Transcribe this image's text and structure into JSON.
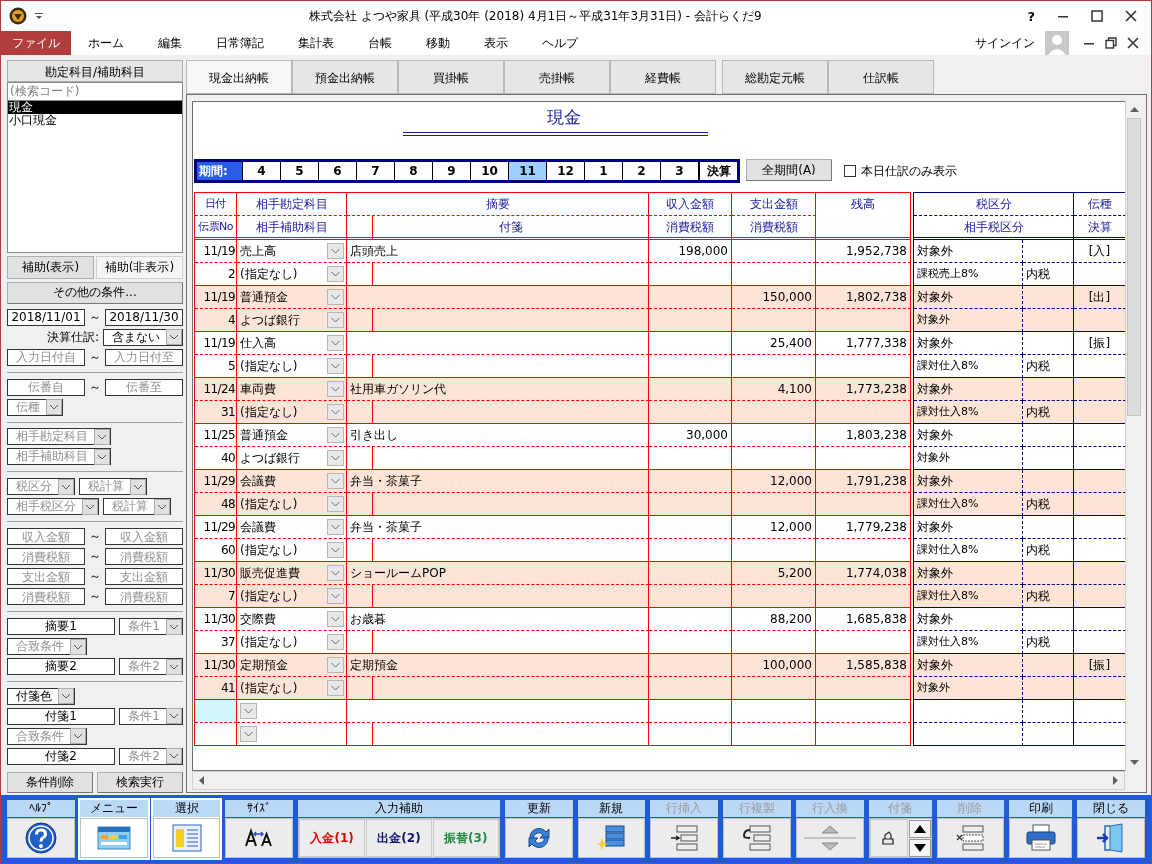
{
  "window": {
    "title": "株式会社 よつや家具 (平成30年 (2018) 4月1日～平成31年3月31日) - 会計らくだ9",
    "help": "?"
  },
  "menu": [
    {
      "label": "ファイル",
      "selected": true
    },
    {
      "label": "ホーム",
      "selected": false
    },
    {
      "label": "編集",
      "selected": false
    },
    {
      "label": "日常簿記",
      "selected": false
    },
    {
      "label": "集計表",
      "selected": false
    },
    {
      "label": "台帳",
      "selected": false
    },
    {
      "label": "移動",
      "selected": false
    },
    {
      "label": "表示",
      "selected": false
    },
    {
      "label": "ヘルプ",
      "selected": false
    }
  ],
  "account": {
    "label": "サインイン"
  },
  "sidebar": {
    "header": "勘定科目/補助科目",
    "search_placeholder": "(検索コード)",
    "accounts": [
      {
        "label": "現金",
        "selected": true
      },
      {
        "label": "小口現金",
        "selected": false
      }
    ],
    "tabs": [
      {
        "label": "補助(表示)",
        "selected": false
      },
      {
        "label": "補助(非表示)",
        "selected": true
      }
    ],
    "more_button": "その他の条件...",
    "filter_groups": [
      [
        [
          {
            "kind": "field",
            "value": "2018/11/01"
          },
          {
            "kind": "tilde",
            "text": "～"
          },
          {
            "kind": "field",
            "value": "2018/11/30"
          }
        ],
        [
          {
            "kind": "label",
            "text": "決算仕訳:"
          },
          {
            "kind": "combo",
            "value": "含まない"
          }
        ],
        [
          {
            "kind": "field",
            "placeholder": "入力日付自"
          },
          {
            "kind": "tilde",
            "text": "～"
          },
          {
            "kind": "field",
            "placeholder": "入力日付至"
          }
        ]
      ],
      [
        [
          {
            "kind": "field",
            "placeholder": "伝番自"
          },
          {
            "kind": "tilde",
            "text": "～"
          },
          {
            "kind": "field",
            "placeholder": "伝番至"
          }
        ],
        [
          {
            "kind": "combo",
            "placeholder": "伝種"
          }
        ]
      ],
      [
        [
          {
            "kind": "combo",
            "placeholder": "相手勘定科目"
          }
        ],
        [
          {
            "kind": "combo",
            "placeholder": "相手補助科目"
          }
        ]
      ],
      [
        [
          {
            "kind": "combo",
            "placeholder": "税区分"
          },
          {
            "kind": "combo",
            "placeholder": "税計算"
          }
        ],
        [
          {
            "kind": "combo",
            "placeholder": "相手税区分"
          },
          {
            "kind": "combo",
            "placeholder": "税計算"
          }
        ]
      ],
      [
        [
          {
            "kind": "field",
            "placeholder": "収入金額"
          },
          {
            "kind": "tilde",
            "text": "～"
          },
          {
            "kind": "field",
            "placeholder": "収入金額"
          }
        ],
        [
          {
            "kind": "field",
            "placeholder": "消費税額"
          },
          {
            "kind": "tilde",
            "text": "～"
          },
          {
            "kind": "field",
            "placeholder": "消費税額"
          }
        ],
        [
          {
            "kind": "field",
            "placeholder": "支出金額"
          },
          {
            "kind": "tilde",
            "text": "～"
          },
          {
            "kind": "field",
            "placeholder": "支出金額"
          }
        ],
        [
          {
            "kind": "field",
            "placeholder": "消費税額"
          },
          {
            "kind": "tilde",
            "text": "～"
          },
          {
            "kind": "field",
            "placeholder": "消費税額"
          }
        ]
      ],
      [
        [
          {
            "kind": "field",
            "value": "摘要1"
          },
          {
            "kind": "combo",
            "placeholder": "条件1"
          }
        ],
        [
          {
            "kind": "combo",
            "placeholder": "合致条件"
          }
        ],
        [
          {
            "kind": "field",
            "value": "摘要2"
          },
          {
            "kind": "combo",
            "placeholder": "条件2"
          }
        ]
      ],
      [
        [
          {
            "kind": "combo",
            "value": "付箋色"
          }
        ],
        [
          {
            "kind": "field",
            "value": "付箋1"
          },
          {
            "kind": "combo",
            "placeholder": "条件1"
          }
        ],
        [
          {
            "kind": "combo",
            "placeholder": "合致条件"
          }
        ],
        [
          {
            "kind": "field",
            "value": "付箋2"
          },
          {
            "kind": "combo",
            "placeholder": "条件2"
          }
        ]
      ]
    ],
    "buttons": [
      "条件削除",
      "検索実行"
    ]
  },
  "ledger": {
    "tab_groups": [
      [
        {
          "label": "現金出納帳",
          "selected": true
        },
        {
          "label": "預金出納帳",
          "selected": false
        },
        {
          "label": "買掛帳",
          "selected": false
        },
        {
          "label": "売掛帳",
          "selected": false
        },
        {
          "label": "経費帳",
          "selected": false
        }
      ],
      [
        {
          "label": "総勘定元帳",
          "selected": false
        },
        {
          "label": "仕訳帳",
          "selected": false
        }
      ]
    ],
    "title": "現金",
    "period": {
      "label": "期間:",
      "months": [
        {
          "label": "4",
          "selected": false
        },
        {
          "label": "5",
          "selected": false
        },
        {
          "label": "6",
          "selected": false
        },
        {
          "label": "7",
          "selected": false
        },
        {
          "label": "8",
          "selected": false
        },
        {
          "label": "9",
          "selected": false
        },
        {
          "label": "10",
          "selected": false
        },
        {
          "label": "11",
          "selected": true
        },
        {
          "label": "12",
          "selected": false
        },
        {
          "label": "1",
          "selected": false
        },
        {
          "label": "2",
          "selected": false
        },
        {
          "label": "3",
          "selected": false
        },
        {
          "label": "決算",
          "selected": false
        }
      ]
    },
    "all_period_button": "全期間(A)",
    "today_only": {
      "label": "本日仕訳のみ表示",
      "checked": false
    },
    "headers": {
      "date": "日付",
      "voucher": "伝票No",
      "account": "相手勘定科目",
      "sub_account": "相手補助科目",
      "memo": "摘要",
      "note": "付箋",
      "income": "収入金額",
      "income_tax": "消費税額",
      "expense": "支出金額",
      "expense_tax": "消費税額",
      "balance": "残高",
      "tax_class": "税区分",
      "partner_tax_class": "相手税区分",
      "slip_type": "伝種",
      "settlement": "決算"
    },
    "entries": [
      {
        "date": "11/19",
        "voucher": "2",
        "account": "売上高",
        "sub_account": "(指定なし)",
        "memo": "店頭売上",
        "income": "198,000",
        "balance": "1,952,738",
        "tax_class": "対象外",
        "partner_tax_class": "課税売上8%",
        "tax_method": "内税",
        "slip_type": "[入]"
      },
      {
        "date": "11/19",
        "voucher": "4",
        "account": "普通預金",
        "sub_account": "よつば銀行",
        "expense": "150,000",
        "balance": "1,802,738",
        "tax_class": "対象外",
        "partner_tax_class": "対象外",
        "slip_type": "[出]"
      },
      {
        "date": "11/19",
        "voucher": "5",
        "account": "仕入高",
        "sub_account": "(指定なし)",
        "expense": "25,400",
        "balance": "1,777,338",
        "tax_class": "対象外",
        "partner_tax_class": "課対仕入8%",
        "tax_method": "内税",
        "slip_type": "[振]"
      },
      {
        "date": "11/24",
        "voucher": "31",
        "account": "車両費",
        "sub_account": "(指定なし)",
        "memo": "社用車ガソリン代",
        "expense": "4,100",
        "balance": "1,773,238",
        "tax_class": "対象外",
        "partner_tax_class": "課対仕入8%",
        "tax_method": "内税"
      },
      {
        "date": "11/25",
        "voucher": "40",
        "account": "普通預金",
        "sub_account": "よつば銀行",
        "memo": "引き出し",
        "income": "30,000",
        "balance": "1,803,238",
        "tax_class": "対象外",
        "partner_tax_class": "対象外"
      },
      {
        "date": "11/29",
        "voucher": "48",
        "account": "会議費",
        "sub_account": "(指定なし)",
        "memo": "弁当・茶菓子",
        "expense": "12,000",
        "balance": "1,791,238",
        "tax_class": "対象外",
        "partner_tax_class": "課対仕入8%",
        "tax_method": "内税"
      },
      {
        "date": "11/29",
        "voucher": "60",
        "account": "会議費",
        "sub_account": "(指定なし)",
        "memo": "弁当・茶菓子",
        "expense": "12,000",
        "balance": "1,779,238",
        "tax_class": "対象外",
        "partner_tax_class": "課対仕入8%",
        "tax_method": "内税"
      },
      {
        "date": "11/30",
        "voucher": "7",
        "account": "販売促進費",
        "sub_account": "(指定なし)",
        "memo": "ショールームPOP",
        "expense": "5,200",
        "balance": "1,774,038",
        "tax_class": "対象外",
        "partner_tax_class": "課対仕入8%",
        "tax_method": "内税"
      },
      {
        "date": "11/30",
        "voucher": "37",
        "account": "交際費",
        "sub_account": "(指定なし)",
        "memo": "お歳暮",
        "expense": "88,200",
        "balance": "1,685,838",
        "tax_class": "対象外",
        "partner_tax_class": "課対仕入8%",
        "tax_method": "内税"
      },
      {
        "date": "11/30",
        "voucher": "41",
        "account": "定期預金",
        "sub_account": "(指定なし)",
        "memo": "定期預金",
        "expense": "100,000",
        "balance": "1,585,838",
        "tax_class": "対象外",
        "partner_tax_class": "対象外",
        "slip_type": "[振]"
      }
    ]
  },
  "toolbar": [
    {
      "label": "ﾍﾙﾌﾟ",
      "kind": "help",
      "disabled": false,
      "selected": false
    },
    {
      "label": "メニュー",
      "kind": "menu",
      "disabled": false,
      "selected": true
    },
    {
      "label": "選択",
      "kind": "select",
      "disabled": false,
      "selected": true
    },
    {
      "label": "ｻｲｽﾞ",
      "kind": "size",
      "disabled": false,
      "selected": false
    },
    {
      "label": "入力補助",
      "kind": "entry",
      "disabled": false,
      "buttons": [
        {
          "label": "入金(1)",
          "color": "#e00000"
        },
        {
          "label": "出金(2)",
          "color": "#10106e"
        },
        {
          "label": "振替(3)",
          "color": "#1f8a40"
        }
      ]
    },
    {
      "label": "更新",
      "kind": "refresh",
      "disabled": false,
      "selected": false
    },
    {
      "label": "新規",
      "kind": "new",
      "disabled": false,
      "selected": false
    },
    {
      "label": "行挿入",
      "kind": "insert",
      "disabled": true,
      "selected": false
    },
    {
      "label": "行複製",
      "kind": "copy",
      "disabled": true,
      "selected": false
    },
    {
      "label": "行入換",
      "kind": "swap",
      "disabled": true,
      "selected": false
    },
    {
      "label": "付箋",
      "kind": "note",
      "disabled": true,
      "selected": false
    },
    {
      "label": "削除",
      "kind": "delete",
      "disabled": true,
      "selected": false
    },
    {
      "label": "印刷",
      "kind": "print",
      "disabled": false,
      "selected": false
    },
    {
      "label": "閉じる",
      "kind": "close",
      "disabled": false,
      "selected": false
    }
  ]
}
